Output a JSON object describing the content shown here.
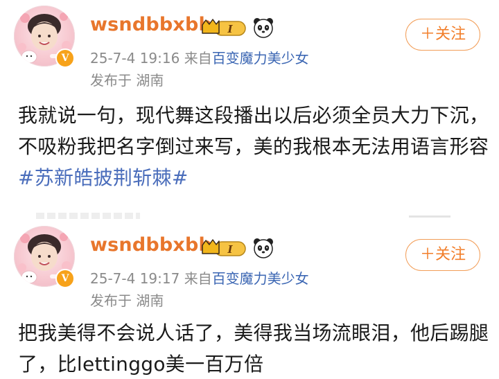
{
  "posts": [
    {
      "username": "wsndbbxbb",
      "level_badge": "I",
      "verified_mark": "V",
      "time": "25-7-4 19:16",
      "source_prefix": "来自",
      "source": "百变魔力美少女",
      "location": "发布于 湖南",
      "follow_label": "＋关注",
      "text": "我就说一句，现代舞这段播出以后必须全员大力下沉，不吸粉我把名字倒过来写，美的我根本无法用语言形容",
      "hashtag": "#苏新皓披荆斩棘#",
      "icons": [
        "avatar",
        "crown-badge-icon",
        "panda-icon",
        "verified-icon"
      ]
    },
    {
      "username": "wsndbbxbb",
      "level_badge": "I",
      "verified_mark": "V",
      "time": "25-7-4 19:17",
      "source_prefix": "来自",
      "source": "百变魔力美少女",
      "location": "发布于 湖南",
      "follow_label": "＋关注",
      "text": "把我美得不会说人话了，美得我当场流眼泪，他后踢腿了，比lettinggo美一百万倍",
      "hashtag": "",
      "icons": [
        "avatar",
        "crown-badge-icon",
        "panda-icon",
        "verified-icon"
      ]
    }
  ],
  "colors": {
    "username": "#e8762c",
    "follow": "#f27e2a",
    "link": "#3b66b3",
    "hashtag": "#4a6dbb",
    "meta": "#8a8a8a",
    "body_text": "#1a1a1a",
    "verified": "#f7a21a"
  }
}
